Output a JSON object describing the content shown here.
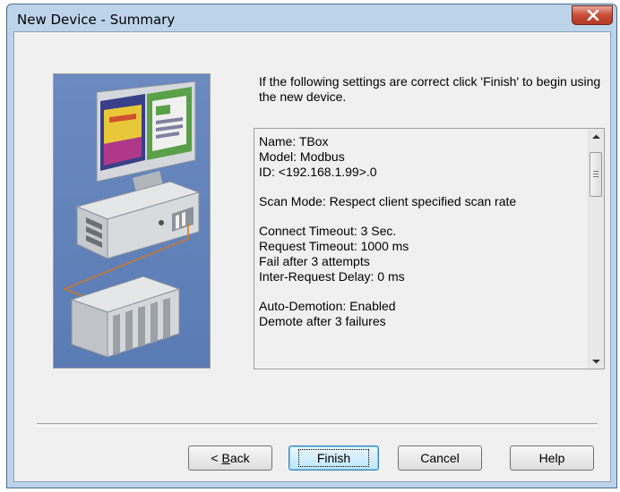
{
  "window": {
    "title": "New Device - Summary",
    "close_glyph": "X"
  },
  "intro": {
    "text": "If the following settings are correct click 'Finish' to begin using the new device."
  },
  "summary": {
    "lines": [
      "Name: TBox",
      "Model: Modbus",
      "ID: <192.168.1.99>.0",
      "",
      "Scan Mode: Respect client specified scan rate",
      "",
      "Connect Timeout: 3 Sec.",
      "Request Timeout: 1000 ms",
      "Fail after 3 attempts",
      "Inter-Request Delay: 0 ms",
      "",
      "Auto-Demotion: Enabled",
      "Demote after 3 failures"
    ]
  },
  "buttons": {
    "back_prefix": "< ",
    "back_mnemonic": "B",
    "back_rest": "ack",
    "finish": "Finish",
    "cancel": "Cancel",
    "help": "Help"
  },
  "icons": {
    "close": "close-icon",
    "scroll_up": "scroll-up-icon",
    "scroll_down": "scroll-down-icon",
    "wizard_picture": "computer-and-plc-illustration"
  },
  "colors": {
    "title_bg": "#bcd3ea",
    "dialog_bg": "#f0f0f0",
    "close_button": "#c74d38",
    "default_button": "#bee6fd",
    "picture_bg": "#5a7bb4"
  }
}
